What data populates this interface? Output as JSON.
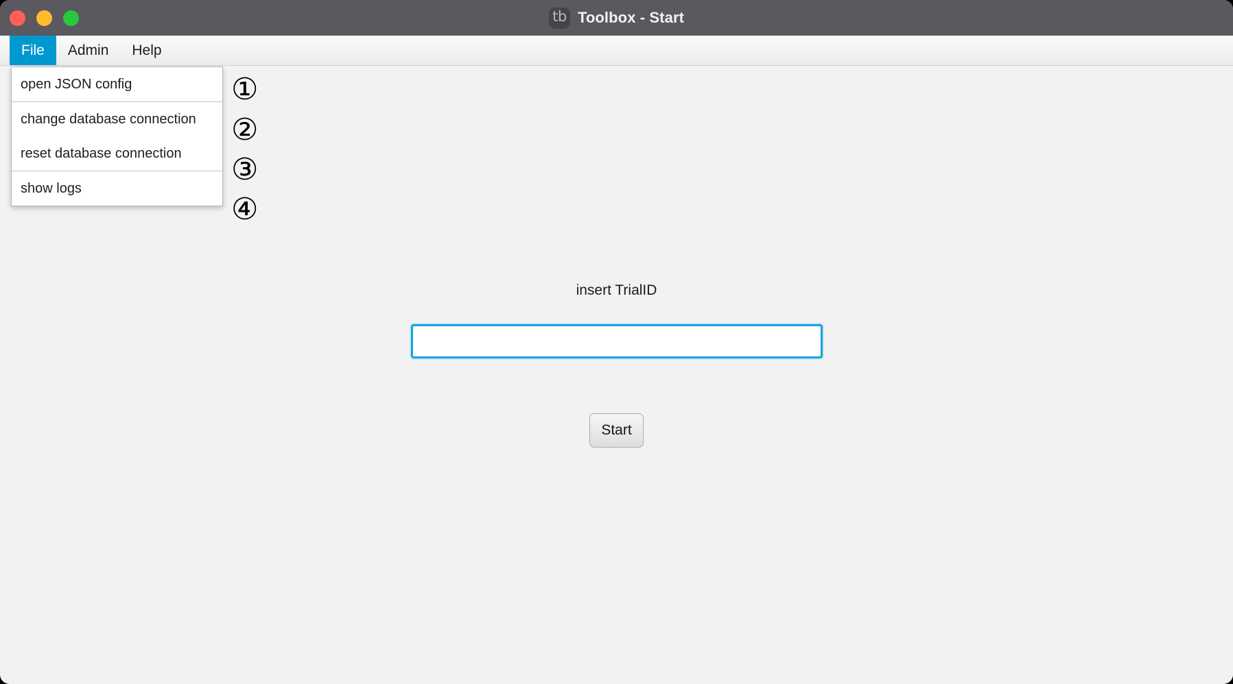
{
  "window": {
    "title": "Toolbox - Start",
    "app_icon_text": "tb",
    "controls": {
      "close_label": "close",
      "minimize_label": "minimize",
      "maximize_label": "maximize"
    }
  },
  "menubar": {
    "items": [
      {
        "label": "File",
        "active": true
      },
      {
        "label": "Admin",
        "active": false
      },
      {
        "label": "Help",
        "active": false
      }
    ]
  },
  "file_menu": {
    "groups": [
      {
        "items": [
          {
            "label": "open JSON config",
            "badge": "①"
          }
        ]
      },
      {
        "items": [
          {
            "label": "change database connection",
            "badge": "②"
          },
          {
            "label": "reset database connection",
            "badge": "③"
          }
        ]
      },
      {
        "items": [
          {
            "label": "show logs",
            "badge": "④"
          }
        ]
      }
    ]
  },
  "badges": [
    "①",
    "②",
    "③",
    "④"
  ],
  "main": {
    "field_label": "insert TrialID",
    "trial_input": {
      "value": "",
      "placeholder": ""
    },
    "start_label": "Start"
  },
  "colors": {
    "titlebar": "#5b5860",
    "accent_blue": "#0099cf",
    "input_focus": "#11a4de",
    "content_bg": "#f2f2f2",
    "close_red": "#ff5f56",
    "minimize_yellow": "#ffbd2e",
    "maximize_green": "#28c840"
  }
}
